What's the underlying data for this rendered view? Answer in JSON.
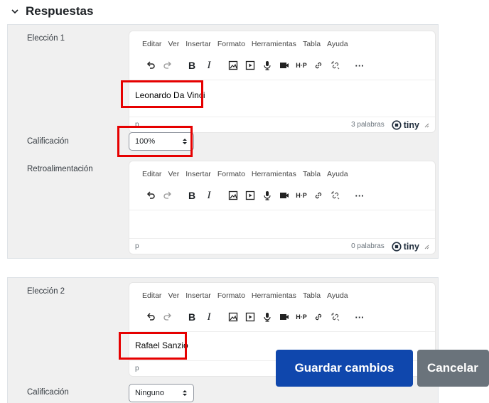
{
  "section": {
    "title": "Respuestas"
  },
  "editor_menu": [
    "Editar",
    "Ver",
    "Insertar",
    "Formato",
    "Herramientas",
    "Tabla",
    "Ayuda"
  ],
  "status_path": "p",
  "tiny_brand": "tiny",
  "answer1": {
    "label": "Elección 1",
    "content": "Leonardo Da Vinci",
    "word_count": "3 palabras",
    "grade_label": "Calificación",
    "grade_value": "100%",
    "feedback_label": "Retroalimentación",
    "feedback_word_count": "0 palabras"
  },
  "answer2": {
    "label": "Elección 2",
    "content": "Rafael Sanzio",
    "grade_label": "Calificación",
    "grade_value": "Ninguno"
  },
  "buttons": {
    "save": "Guardar cambios",
    "cancel": "Cancelar"
  },
  "colors": {
    "highlight": "#e60000",
    "primary": "#0f47ad",
    "secondary": "#6a737b"
  },
  "icons": [
    "undo-icon",
    "redo-icon",
    "bold-icon",
    "italic-icon",
    "image-icon",
    "media-icon",
    "microphone-icon",
    "video-camera-icon",
    "h5p-icon",
    "link-icon",
    "unlink-icon",
    "more-icon"
  ]
}
